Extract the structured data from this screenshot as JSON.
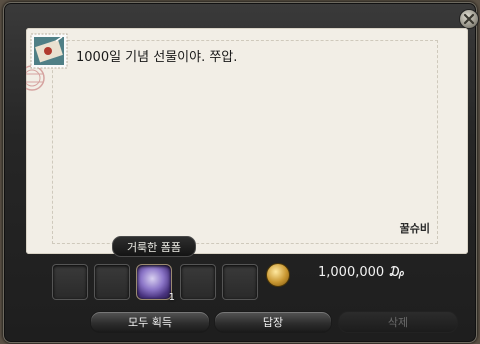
{
  "letter": {
    "message": "1000일 기념 선물이야. 쭈압.",
    "sender": "꿀슈비"
  },
  "attachments": {
    "tooltip": "거룩한 폼폼",
    "slots": [
      {
        "filled": false
      },
      {
        "filled": false
      },
      {
        "filled": true,
        "item": "holy-pompom",
        "quantity": "1"
      },
      {
        "filled": false
      },
      {
        "filled": false
      }
    ],
    "gil_amount": "1,000,000 ₯"
  },
  "buttons": {
    "take_all": "모두 획득",
    "reply": "답장",
    "delete": "삭제"
  },
  "colors": {
    "paper": "#f2eee6",
    "window": "#262626",
    "item_glow": "#8c76c8"
  }
}
